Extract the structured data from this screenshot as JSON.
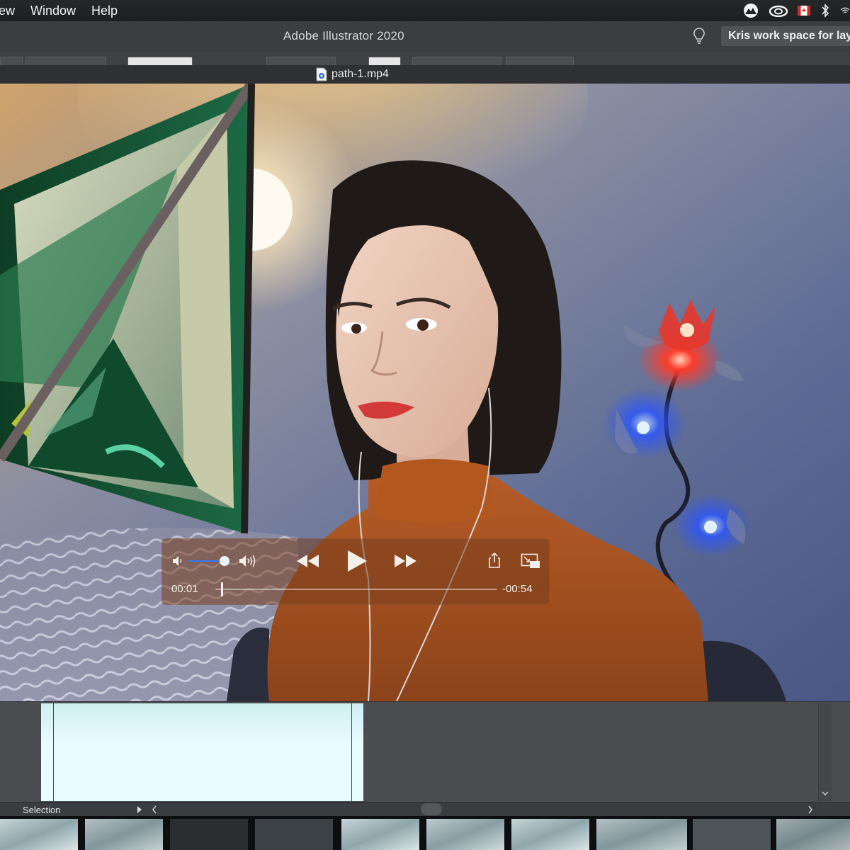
{
  "menubar": {
    "items": [
      "iew",
      "Window",
      "Help"
    ],
    "status_icons": [
      "cloud-app-icon",
      "creative-cloud-icon",
      "canada-flag-icon",
      "bluetooth-icon",
      "wifi-icon"
    ]
  },
  "app": {
    "title": "Adobe Illustrator 2020",
    "workspace": "Kris work space for lay"
  },
  "document": {
    "tab_label": "path-1.mp4"
  },
  "player": {
    "current_time": "00:01",
    "remaining_time": "-00:54",
    "volume_fraction": 0.85,
    "progress_fraction": 0.02,
    "controls": [
      "volume-low-icon",
      "volume-high-icon",
      "rewind-icon",
      "play-icon",
      "fast-forward-icon",
      "share-icon",
      "picture-in-picture-icon"
    ],
    "accent_color": "#3478f6"
  },
  "statusbar": {
    "tool": "Selection"
  }
}
